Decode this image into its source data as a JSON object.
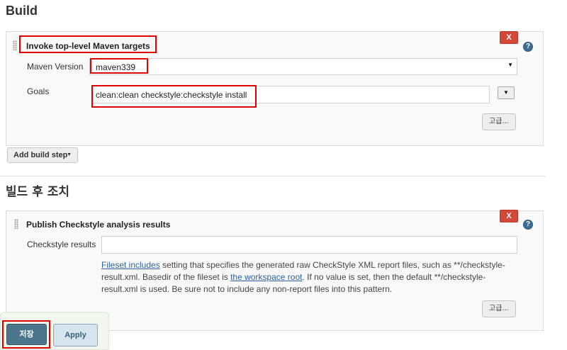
{
  "build": {
    "heading": "Build",
    "step": {
      "title": "Invoke top-level Maven targets",
      "delete_label": "X",
      "help_label": "?",
      "maven_version_label": "Maven Version",
      "maven_version_value": "maven339",
      "goals_label": "Goals",
      "goals_value": "clean:clean checkstyle:checkstyle install",
      "advanced_label": "고급..."
    },
    "add_build_step_label": "Add build step"
  },
  "post_build": {
    "heading": "빌드 후 조치",
    "step": {
      "title": "Publish Checkstyle analysis results",
      "delete_label": "X",
      "help_label": "?",
      "results_label": "Checkstyle results",
      "results_value": "",
      "desc_link1": "Fileset includes",
      "desc_text1": " setting that specifies the generated raw CheckStyle XML report files, such as **/checkstyle-result.xml. Basedir of the fileset is ",
      "desc_link2": "the workspace root",
      "desc_text2": ". If no value is set, then the default **/checkstyle-result.xml is used. Be sure not to include any non-report files into this pattern.",
      "advanced_label": "고급..."
    }
  },
  "footer": {
    "save_label": "저장",
    "apply_label": "Apply"
  },
  "colors": {
    "annotation": "#e00000",
    "delete": "#d24939",
    "save": "#4b758b",
    "link": "#2b61a4"
  }
}
